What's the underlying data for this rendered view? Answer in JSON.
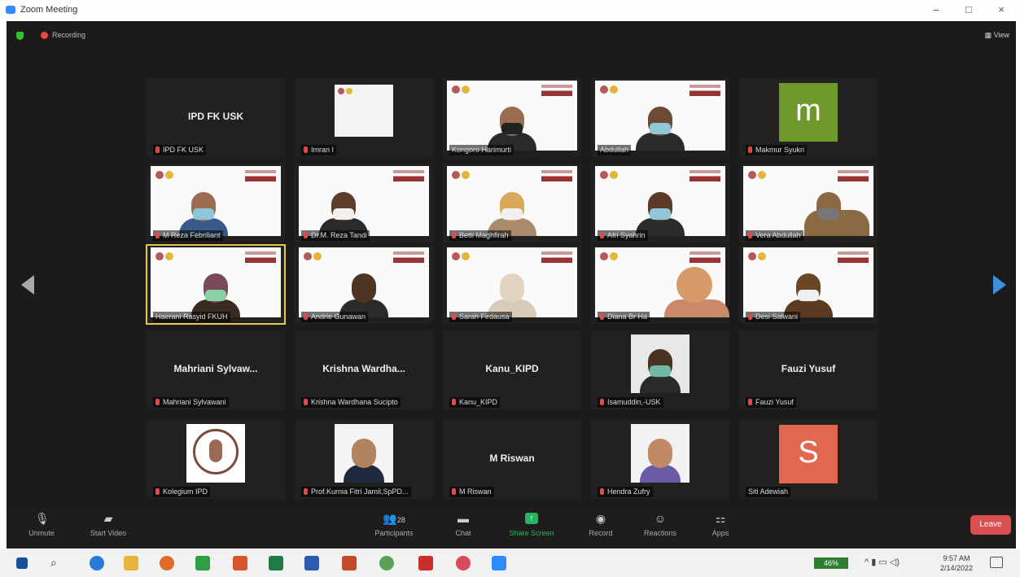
{
  "window": {
    "title": "Zoom Meeting",
    "minimize": "–",
    "maximize": "□",
    "close": "×"
  },
  "meeting": {
    "recording_label": "Recording",
    "view_label": "View"
  },
  "tiles": {
    "t1": {
      "big": "IPD FK USK",
      "label": "IPD FK USK"
    },
    "t2": {
      "label": "Imran I"
    },
    "t3": {
      "label": "Kongoro Harimurti"
    },
    "t4": {
      "label": "Abdullah"
    },
    "t5": {
      "avatar": "m",
      "label": "Makmur Syukri"
    },
    "t6": {
      "label": "M Reza Febriliant"
    },
    "t7": {
      "label": "Dr.M. Reza Tandi"
    },
    "t8": {
      "label": "Betti Maghfirah"
    },
    "t9": {
      "label": "Afri Syahrin"
    },
    "t10": {
      "label": "Vera Abdullah"
    },
    "t11": {
      "label": "Haerani Rasyid FKUH"
    },
    "t12": {
      "label": "Andrie Gunawan"
    },
    "t13": {
      "label": "Sarah Firdausa"
    },
    "t14": {
      "label": "Diana Br Ha"
    },
    "t15": {
      "label": "Desi Salwani"
    },
    "t16": {
      "big": "Mahriani Sylvaw...",
      "label": "Mahriani Sylvawani"
    },
    "t17": {
      "big": "Krishna Wardha...",
      "label": "Krishna Wardhana Sucipto"
    },
    "t18": {
      "big": "Kanu_KIPD",
      "label": "Kanu_KIPD"
    },
    "t19": {
      "label": "Isamuddin,-USK"
    },
    "t20": {
      "big": "Fauzi Yusuf",
      "label": "Fauzi Yusuf"
    },
    "t21": {
      "label": "Kolegium IPD"
    },
    "t22": {
      "label": "Prof.Kurnia Fitri Jamil,SpPD..."
    },
    "t23": {
      "big": "M Riswan",
      "label": "M Riswan"
    },
    "t24": {
      "label": "Hendra Zufry"
    },
    "t25": {
      "avatar": "S",
      "label": "Siti Adewiah"
    }
  },
  "toolbar": {
    "unmute": "Unmute",
    "start_video": "Start Video",
    "participants": "Participants",
    "participants_count": "28",
    "chat": "Chat",
    "share": "Share Screen",
    "record": "Record",
    "reactions": "Reactions",
    "apps": "Apps",
    "leave": "Leave"
  },
  "taskbar": {
    "battery": "46%",
    "time": "9:57 AM",
    "date": "2/14/2022"
  },
  "colors": {
    "avatar_m": "#6f9a2b",
    "avatar_s": "#e2674f",
    "share_green": "#25b360",
    "leave_red": "#d94f4f"
  }
}
